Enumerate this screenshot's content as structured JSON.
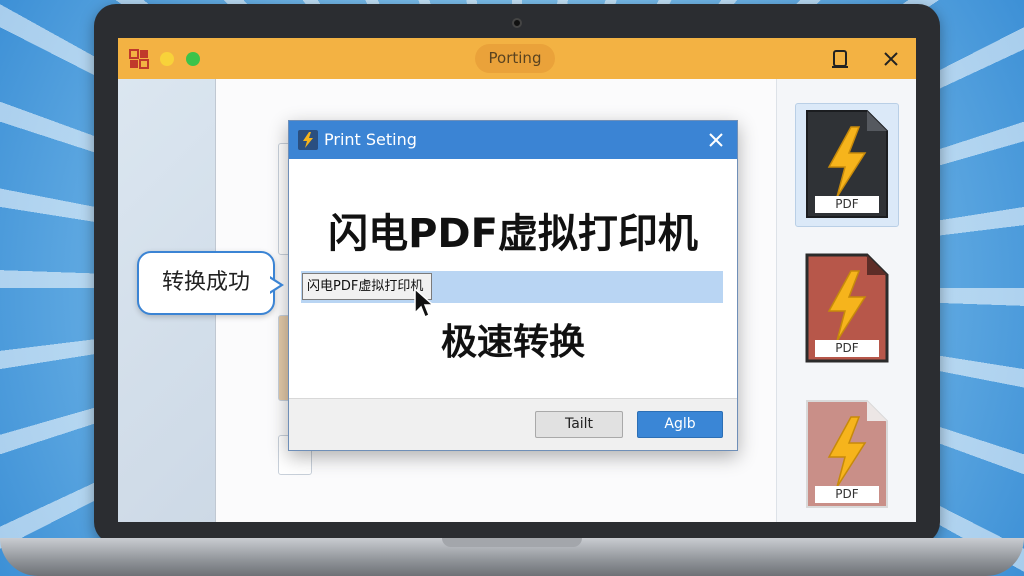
{
  "window": {
    "title": "Porting",
    "restore_icon": "restore-icon",
    "close_icon": "close-icon"
  },
  "dialog": {
    "title": "Print Seting",
    "heading": "闪电PDF虚拟打印机",
    "printer_value": "闪电PDF虚拟打印机",
    "subheading": "极速转换",
    "cancel_label": "Tailt",
    "apply_label": "Aglb"
  },
  "callout": {
    "text": "转换成功"
  },
  "files": [
    {
      "label": "PDF"
    },
    {
      "label": "PDF"
    },
    {
      "label": "PDF"
    }
  ],
  "colors": {
    "titlebar": "#f3b243",
    "dialog_title": "#3b84d4",
    "accent_blue": "#3a86d6",
    "lightning": "#f6b41c",
    "file_dark": "#2f3236",
    "file_red": "#b7574a"
  }
}
